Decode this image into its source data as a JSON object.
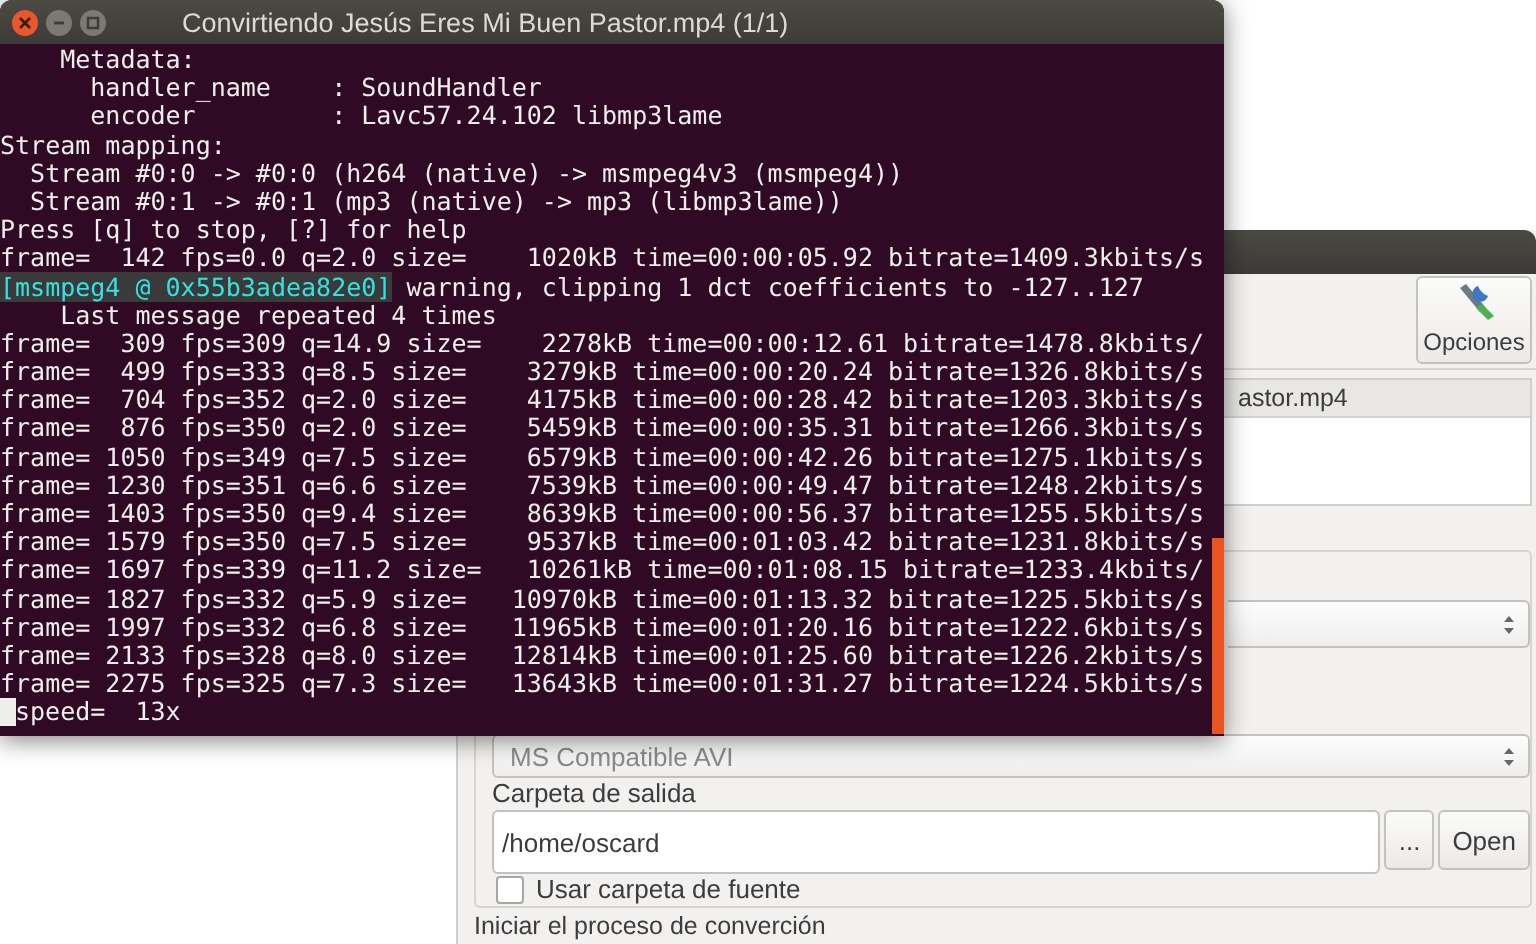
{
  "terminal": {
    "title": "Convirtiendo Jesús Eres Mi Buen Pastor.mp4 (1/1)",
    "lines": [
      {
        "text": "    Metadata:"
      },
      {
        "text": "      handler_name    : SoundHandler"
      },
      {
        "text": "      encoder         : Lavc57.24.102 libmp3lame"
      },
      {
        "text": "Stream mapping:"
      },
      {
        "text": "  Stream #0:0 -> #0:0 (h264 (native) -> msmpeg4v3 (msmpeg4))"
      },
      {
        "text": "  Stream #0:1 -> #0:1 (mp3 (native) -> mp3 (libmp3lame))"
      },
      {
        "text": "Press [q] to stop, [?] for help"
      },
      {
        "text": "frame=  142 fps=0.0 q=2.0 size=    1020kB time=00:00:05.92 bitrate=1409.3kbits/s"
      },
      {
        "tag": "[msmpeg4 @ 0x55b3adea82e0]",
        "text": " warning, clipping 1 dct coefficients to -127..127"
      },
      {
        "text": "    Last message repeated 4 times"
      },
      {
        "text": "frame=  309 fps=309 q=14.9 size=    2278kB time=00:00:12.61 bitrate=1478.8kbits/"
      },
      {
        "text": "frame=  499 fps=333 q=8.5 size=    3279kB time=00:00:20.24 bitrate=1326.8kbits/s"
      },
      {
        "text": "frame=  704 fps=352 q=2.0 size=    4175kB time=00:00:28.42 bitrate=1203.3kbits/s"
      },
      {
        "text": "frame=  876 fps=350 q=2.0 size=    5459kB time=00:00:35.31 bitrate=1266.3kbits/s"
      },
      {
        "text": "frame= 1050 fps=349 q=7.5 size=    6579kB time=00:00:42.26 bitrate=1275.1kbits/s"
      },
      {
        "text": "frame= 1230 fps=351 q=6.6 size=    7539kB time=00:00:49.47 bitrate=1248.2kbits/s"
      },
      {
        "text": "frame= 1403 fps=350 q=9.4 size=    8639kB time=00:00:56.37 bitrate=1255.5kbits/s"
      },
      {
        "text": "frame= 1579 fps=350 q=7.5 size=    9537kB time=00:01:03.42 bitrate=1231.8kbits/s"
      },
      {
        "text": "frame= 1697 fps=339 q=11.2 size=   10261kB time=00:01:08.15 bitrate=1233.4kbits/"
      },
      {
        "text": "frame= 1827 fps=332 q=5.9 size=   10970kB time=00:01:13.32 bitrate=1225.5kbits/s"
      },
      {
        "text": "frame= 1997 fps=332 q=6.8 size=   11965kB time=00:01:20.16 bitrate=1222.6kbits/s"
      },
      {
        "text": "frame= 2133 fps=328 q=8.0 size=   12814kB time=00:01:25.60 bitrate=1226.2kbits/s"
      },
      {
        "text": "frame= 2275 fps=325 q=7.3 size=   13643kB time=00:01:31.27 bitrate=1224.5kbits/s"
      }
    ],
    "prompt_line": "speed=  13x"
  },
  "converter": {
    "toolbar": [
      {
        "label": "Opciones"
      }
    ],
    "file_list": {
      "column_text": "astor.mp4"
    },
    "format_select": {
      "value": "MS Compatible AVI"
    },
    "output_folder": {
      "label": "Carpeta de salida",
      "value": "/home/oscard",
      "browse_button": "...",
      "open_button": "Open"
    },
    "use_source_folder": {
      "label": "Usar carpeta de fuente",
      "checked": false
    },
    "status_bar": "Iniciar el proceso de converción"
  }
}
